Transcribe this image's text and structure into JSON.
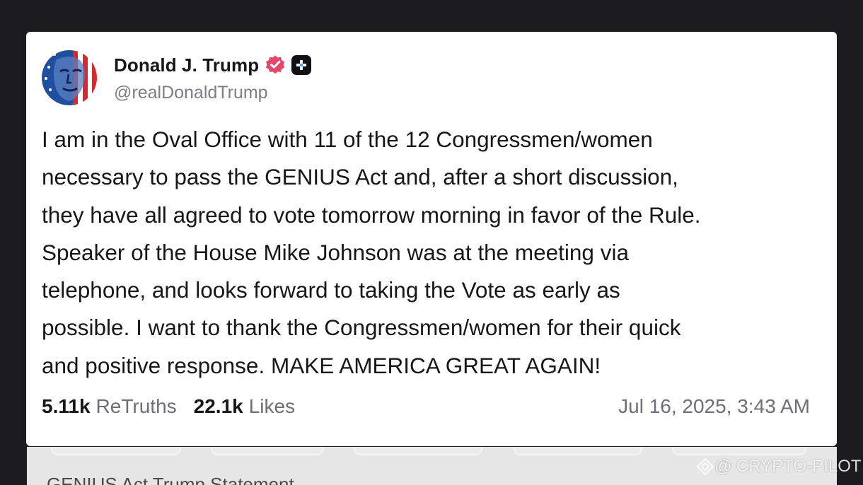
{
  "post": {
    "author": {
      "display_name": "Donald J. Trump",
      "handle": "@realDonaldTrump",
      "verified_icon": "verified-badge-icon",
      "plus_icon": "plus-badge-icon"
    },
    "text": "I am in the Oval Office with 11 of the 12 Congressmen/women\nnecessary to pass the GENIUS Act and, after a short discussion,\nthey have all agreed to vote tomorrow morning in favor of the Rule.\nSpeaker of the House Mike Johnson was at the meeting via\ntelephone, and looks forward to taking the Vote as early as\npossible. I want to thank the Congressmen/women for their quick\nand positive response. MAKE AMERICA GREAT AGAIN!",
    "stats": {
      "retruths_count": "5.11k",
      "retruths_label": "ReTruths",
      "likes_count": "22.1k",
      "likes_label": "Likes"
    },
    "timestamp": "Jul 16, 2025, 3:43 AM"
  },
  "caption": "GENIUS Act Trump Statement",
  "watermark": {
    "text": "@ CRYPTO-PILOT"
  },
  "colors": {
    "background": "#1c1c1e",
    "card": "#ffffff",
    "verified": "#e5476b",
    "text": "#17171a",
    "muted": "#6e6e78"
  }
}
